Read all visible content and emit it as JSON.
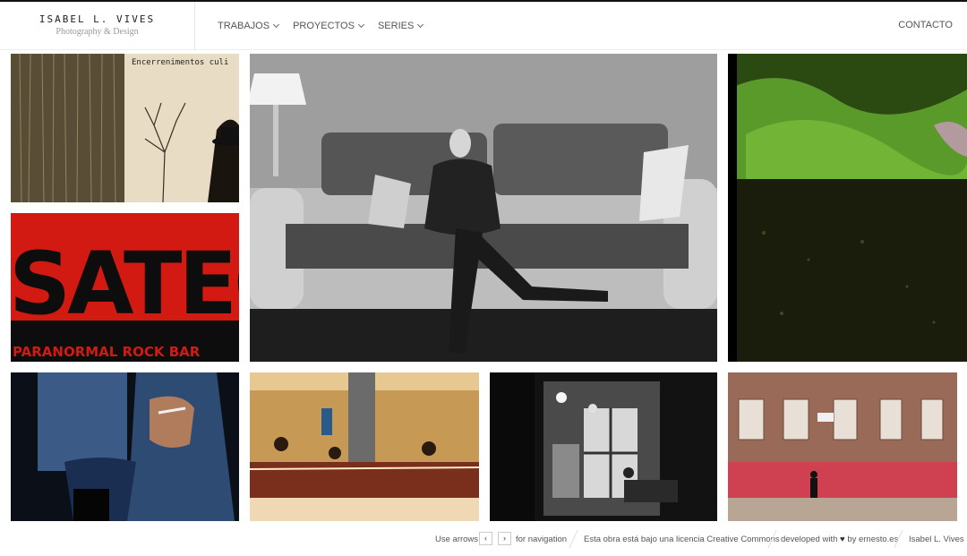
{
  "header": {
    "logo_name": "ISABEL L. VIVES",
    "logo_sub": "Photography & Design",
    "nav": [
      {
        "label": "TRABAJOS"
      },
      {
        "label": "PROYECTOS"
      },
      {
        "label": "SERIES"
      }
    ],
    "contact": "CONTACTO"
  },
  "gallery": {
    "poster_text_top": "Encerrenimentos culi",
    "poster_text_bottom": "PARANORMAL ROCK BAR",
    "poster_brand": "SATEO"
  },
  "footer": {
    "use_arrows": "Use arrows",
    "prev_arrow": "‹",
    "next_arrow": "›",
    "for_navigation": "for navigation",
    "license": "Esta obra está bajo una licencia Creative Commons",
    "developed_prefix": "developed with",
    "heart": "♥",
    "developed_suffix": "by ernesto.es",
    "author": "Isabel L. Vives"
  },
  "colors": {
    "accent_red": "#d21a12",
    "green_sky": "#5a9a2a"
  }
}
